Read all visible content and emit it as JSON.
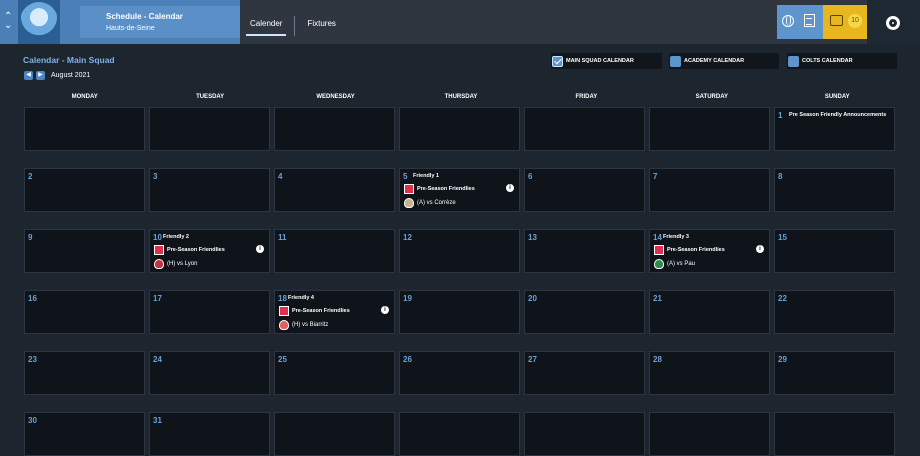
{
  "header": {
    "breadcrumb_title": "Schedule - Calendar",
    "breadcrumb_sub": "Hauts-de-Seine",
    "tabs": [
      {
        "label": "Calender",
        "active": true
      },
      {
        "label": "Fixtures",
        "active": false
      }
    ],
    "inbox_count": "10"
  },
  "page": {
    "title": "Calendar - Main Squad",
    "month": "August 2021",
    "toggles": [
      {
        "label": "MAIN SQUAD CALENDAR",
        "checked": true
      },
      {
        "label": "ACADEMY CALENDAR",
        "checked": false
      },
      {
        "label": "COLTS CALENDAR",
        "checked": false
      }
    ]
  },
  "calendar": {
    "weekdays": [
      "MONDAY",
      "TUESDAY",
      "WEDNESDAY",
      "THURSDAY",
      "FRIDAY",
      "SATURDAY",
      "SUNDAY"
    ],
    "days": [
      "1",
      "2",
      "3",
      "4",
      "5",
      "6",
      "7",
      "8",
      "9",
      "10",
      "11",
      "12",
      "13",
      "14",
      "15",
      "16",
      "17",
      "18",
      "19",
      "20",
      "21",
      "22",
      "23",
      "24",
      "25",
      "26",
      "27",
      "28",
      "29",
      "30",
      "31"
    ],
    "announcement": "Pre Season Friendly Announcements",
    "events": [
      {
        "day": "5",
        "title": "Friendly 1",
        "competition": "Pre-Season Friendlies",
        "opponent": "(A) vs Corrèze",
        "info": "i"
      },
      {
        "day": "10",
        "title": "Friendly 2",
        "competition": "Pre-Season Friendlies",
        "opponent": "(H) vs Lyon",
        "info": "i"
      },
      {
        "day": "14",
        "title": "Friendly 3",
        "competition": "Pre-Season Friendlies",
        "opponent": "(A) vs Pau",
        "info": "i"
      },
      {
        "day": "18",
        "title": "Friendly 4",
        "competition": "Pre-Season Friendlies",
        "opponent": "(H) vs Biarritz",
        "info": "i"
      }
    ]
  },
  "colors": {
    "accent": "#4a7fb8",
    "gold": "#e8b61e",
    "day_number": "#6aa0d6",
    "competition": "#e03050"
  }
}
